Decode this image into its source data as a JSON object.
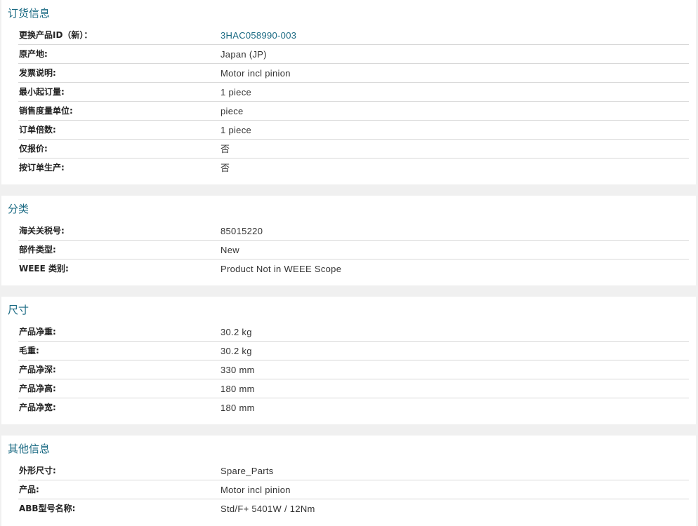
{
  "colors": {
    "accent": "#1a6a83",
    "background": "#f0f0f0",
    "panel": "#ffffff",
    "divider": "#d8d8d8"
  },
  "ordering": {
    "title": "订货信息",
    "rows": [
      {
        "label": "更换产品ID（新）：",
        "value": "3HAC058990-003"
      },
      {
        "label": "原产地:",
        "value": "Japan (JP)"
      },
      {
        "label": "发票说明:",
        "value": "Motor incl pinion"
      },
      {
        "label": "最小起订量:",
        "value": "1 piece"
      },
      {
        "label": "销售度量单位:",
        "value": "piece"
      },
      {
        "label": "订单倍数:",
        "value": "1 piece"
      },
      {
        "label": "仅报价:",
        "value": "否"
      },
      {
        "label": "按订单生产:",
        "value": "否"
      }
    ]
  },
  "classification": {
    "title": "分类",
    "rows": [
      {
        "label": "海关关税号:",
        "value": "85015220"
      },
      {
        "label": "部件类型:",
        "value": "New"
      },
      {
        "label": "WEEE 类别:",
        "value": "Product Not in WEEE Scope"
      }
    ]
  },
  "dimensions": {
    "title": "尺寸",
    "rows": [
      {
        "label": "产品净重:",
        "value": "30.2 kg"
      },
      {
        "label": "毛重:",
        "value": "30.2 kg"
      },
      {
        "label": "产品净深:",
        "value": "330 mm"
      },
      {
        "label": "产品净高:",
        "value": "180 mm"
      },
      {
        "label": "产品净宽:",
        "value": "180 mm"
      }
    ]
  },
  "other": {
    "title": "其他信息",
    "rows": [
      {
        "label": "外形尺寸:",
        "value": "Spare_Parts"
      },
      {
        "label": "产品:",
        "value": "Motor incl pinion"
      },
      {
        "label": "ABB型号名称:",
        "value": "Std/F+ 5401W / 12Nm"
      }
    ]
  }
}
